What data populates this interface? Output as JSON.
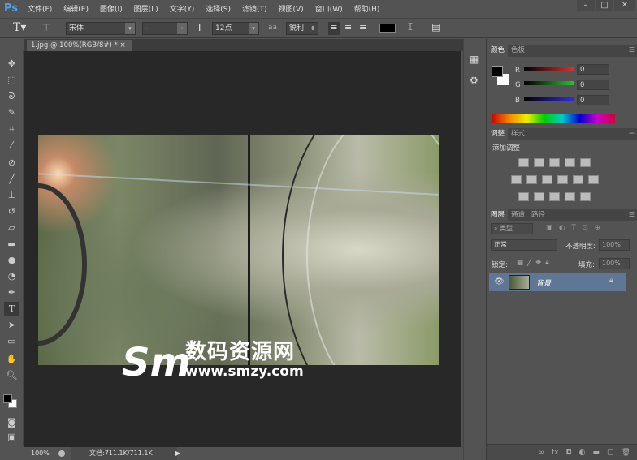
{
  "app": {
    "logo": "Ps"
  },
  "menu": [
    "文件(F)",
    "编辑(E)",
    "图像(I)",
    "图层(L)",
    "文字(Y)",
    "选择(S)",
    "滤镜(T)",
    "视图(V)",
    "窗口(W)",
    "帮助(H)"
  ],
  "window_controls": {
    "minimize": "–",
    "maximize": "□",
    "close": "✕"
  },
  "options": {
    "font_family": "宋体",
    "font_style": "-",
    "font_size": "12点",
    "antialias_icon": "aa",
    "antialias": "锐利",
    "text_color": "#000000"
  },
  "document": {
    "tab_title": "1.jpg @ 100%(RGB/8#) *",
    "close": "×"
  },
  "status": {
    "zoom": "100%",
    "doc_size": "文档:711.1K/711.1K"
  },
  "watermark": {
    "logo": "Sm",
    "title": "数码资源网",
    "url": "www.smzy.com"
  },
  "color_panel": {
    "tabs": [
      "颜色",
      "色板"
    ],
    "channels": [
      {
        "label": "R",
        "value": "0",
        "color": "#e03030"
      },
      {
        "label": "G",
        "value": "0",
        "color": "#30c030"
      },
      {
        "label": "B",
        "value": "0",
        "color": "#3030e0"
      }
    ]
  },
  "adjust_panel": {
    "tabs": [
      "调整",
      "样式"
    ],
    "heading": "添加调整"
  },
  "layers_panel": {
    "tabs": [
      "图层",
      "通道",
      "路径"
    ],
    "filter": "类型",
    "blend_mode": "正常",
    "opacity_label": "不透明度:",
    "opacity": "100%",
    "lock_label": "锁定:",
    "fill_label": "填充:",
    "fill": "100%",
    "layers": [
      {
        "name": "背景",
        "visible": true,
        "locked": true
      }
    ]
  }
}
